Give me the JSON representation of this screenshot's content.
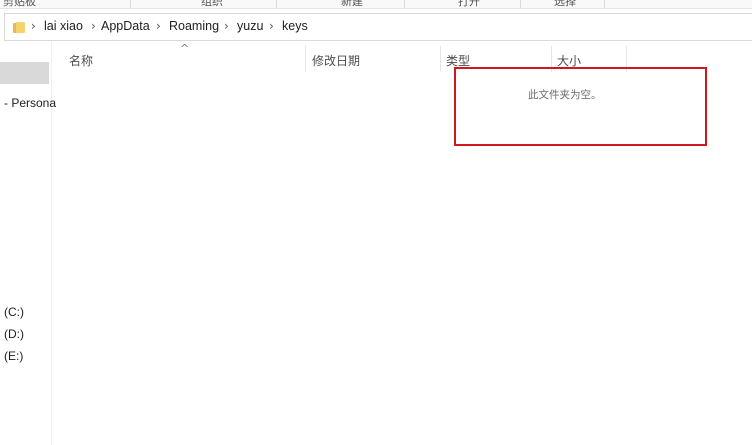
{
  "ribbon": {
    "groups": [
      "剪贴板",
      "组织",
      "新建",
      "打开",
      "选择"
    ]
  },
  "address": {
    "breadcrumbs": [
      "lai xiao",
      "AppData",
      "Roaming",
      "yuzu",
      "keys"
    ]
  },
  "nav": {
    "items": [
      "- Persona",
      "(C:)",
      "(D:)",
      "(E:)"
    ]
  },
  "columns": {
    "name": "名称",
    "date_modified": "修改日期",
    "type": "类型",
    "size": "大小"
  },
  "content": {
    "empty_message": "此文件夹为空。"
  },
  "colors": {
    "highlight": "#d0191f",
    "folder": "#f6d36a",
    "nav_selected": "#d9d9d9"
  }
}
